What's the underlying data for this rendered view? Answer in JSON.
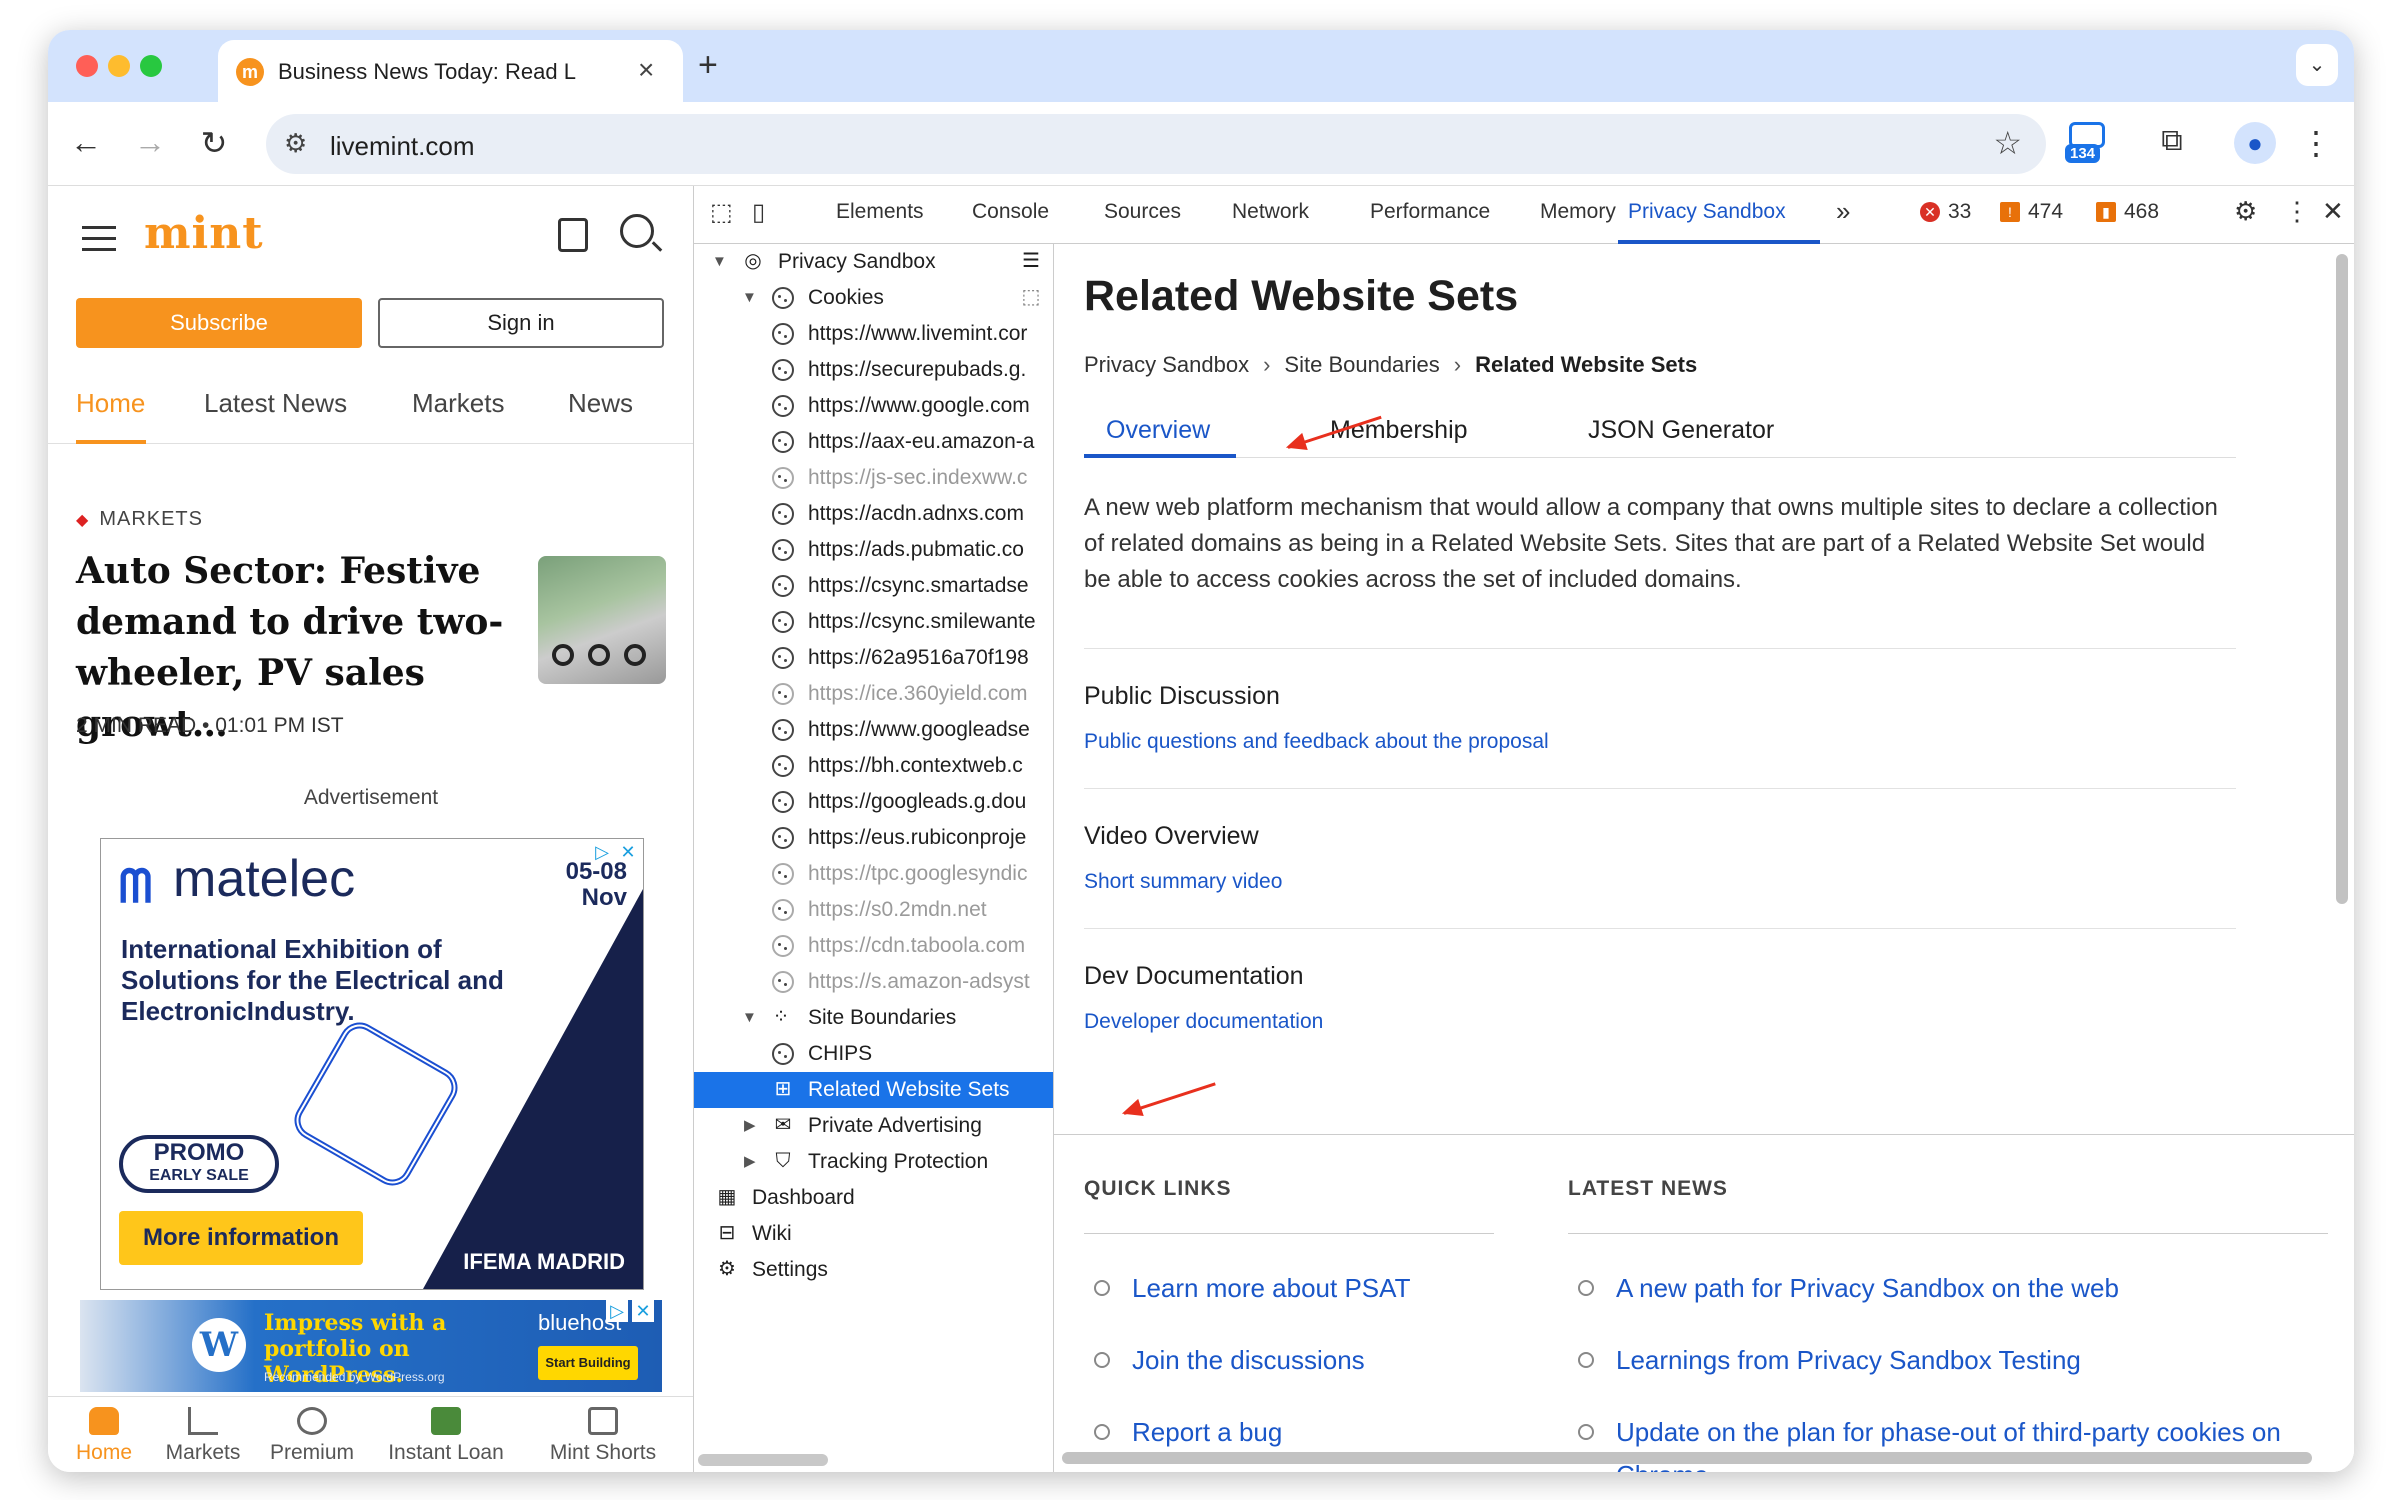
{
  "browser": {
    "tab_title": "Business News Today: Read L",
    "url": "livemint.com",
    "extension_badge": "134"
  },
  "mint": {
    "logo": "mint",
    "subscribe": "Subscribe",
    "sign_in": "Sign in",
    "nav": [
      "Home",
      "Latest News",
      "Markets",
      "News"
    ],
    "category": "MARKETS",
    "headline": "Auto Sector: Festive demand to drive two-wheeler, PV sales growt…",
    "read_time": "2 MIN READ",
    "time": "01:01 PM IST",
    "ad_label": "Advertisement",
    "ad1": {
      "brand": "matelec",
      "date_top": "05-08",
      "date_bottom": "Nov",
      "body": "International Exhibition of Solutions for the Electrical and ElectronicIndustry.",
      "promo": "PROMO",
      "promo_sub": "EARLY SALE",
      "cta": "More information",
      "sponsor": "IFEMA MADRID"
    },
    "ad2": {
      "text": "Impress with a portfolio on WordPress.",
      "recommended": "Recommended by WordPress.org",
      "host": "bluehost",
      "cta": "Start Building"
    },
    "bottom_nav": [
      "Home",
      "Markets",
      "Premium",
      "Instant Loan",
      "Mint Shorts"
    ]
  },
  "devtools": {
    "tabs": [
      "Elements",
      "Console",
      "Sources",
      "Network",
      "Performance",
      "Memory",
      "Privacy Sandbox"
    ],
    "errors": "33",
    "warnings": "474",
    "issues": "468",
    "tree": {
      "root": "Privacy Sandbox",
      "cookies": "Cookies",
      "cookie_items": [
        {
          "label": "https://www.livemint.cor",
          "dim": false
        },
        {
          "label": "https://securepubads.g.",
          "dim": false
        },
        {
          "label": "https://www.google.com",
          "dim": false
        },
        {
          "label": "https://aax-eu.amazon-a",
          "dim": false
        },
        {
          "label": "https://js-sec.indexww.c",
          "dim": true
        },
        {
          "label": "https://acdn.adnxs.com",
          "dim": false
        },
        {
          "label": "https://ads.pubmatic.co",
          "dim": false
        },
        {
          "label": "https://csync.smartadse",
          "dim": false
        },
        {
          "label": "https://csync.smilewante",
          "dim": false
        },
        {
          "label": "https://62a9516a70f198",
          "dim": false
        },
        {
          "label": "https://ice.360yield.com",
          "dim": true
        },
        {
          "label": "https://www.googleadse",
          "dim": false
        },
        {
          "label": "https://bh.contextweb.c",
          "dim": false
        },
        {
          "label": "https://googleads.g.dou",
          "dim": false
        },
        {
          "label": "https://eus.rubiconproje",
          "dim": false
        },
        {
          "label": "https://tpc.googlesyndic",
          "dim": true
        },
        {
          "label": "https://s0.2mdn.net",
          "dim": true
        },
        {
          "label": "https://cdn.taboola.com",
          "dim": true
        },
        {
          "label": "https://s.amazon-adsyst",
          "dim": true
        }
      ],
      "site_boundaries": "Site Boundaries",
      "chips": "CHIPS",
      "rws": "Related Website Sets",
      "private_advertising": "Private Advertising",
      "tracking_protection": "Tracking Protection",
      "dashboard": "Dashboard",
      "wiki": "Wiki",
      "settings": "Settings"
    },
    "page": {
      "title": "Related Website Sets",
      "breadcrumb": [
        "Privacy Sandbox",
        "Site Boundaries",
        "Related Website Sets"
      ],
      "tabs": [
        "Overview",
        "Membership",
        "JSON Generator"
      ],
      "description": "A new web platform mechanism that would allow a company that owns multiple sites to declare a collection of related domains as being in a Related Website Sets. Sites that are part of a Related Website Set would be able to access cookies across the set of included domains.",
      "sections": [
        {
          "heading": "Public Discussion",
          "link": "Public questions and feedback about the proposal"
        },
        {
          "heading": "Video Overview",
          "link": "Short summary video"
        },
        {
          "heading": "Dev Documentation",
          "link": "Developer documentation"
        }
      ],
      "quick_links_heading": "QUICK LINKS",
      "quick_links": [
        "Learn more about PSAT",
        "Join the discussions",
        "Report a bug"
      ],
      "latest_news_heading": "LATEST NEWS",
      "latest_news": [
        "A new path for Privacy Sandbox on the web",
        "Learnings from Privacy Sandbox Testing",
        "Update on the plan for phase-out of third-party cookies on Chrome"
      ]
    }
  },
  "colors": {
    "accent_blue": "#1a56c8",
    "mint_orange": "#f7931e",
    "selection_blue": "#1a73e8",
    "annotation_red": "#e8301e"
  }
}
